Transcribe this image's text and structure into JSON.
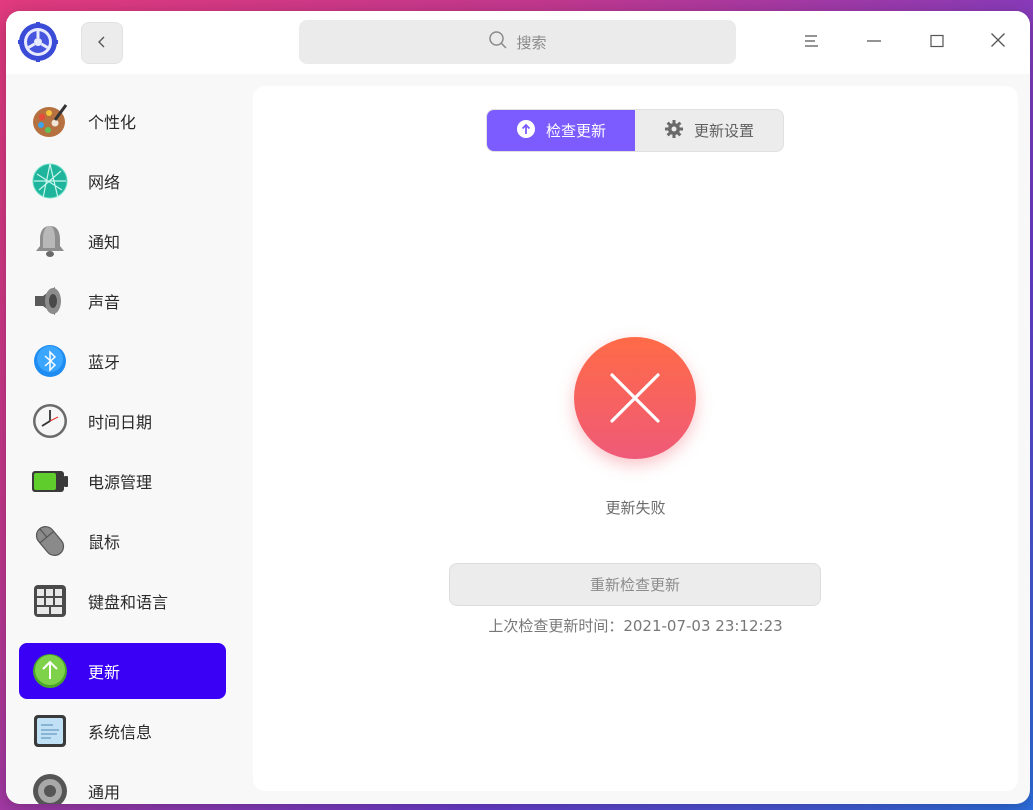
{
  "header": {
    "search_placeholder": "搜索"
  },
  "sidebar": {
    "items": [
      {
        "label": "个性化",
        "icon": "personalization-icon"
      },
      {
        "label": "网络",
        "icon": "network-icon"
      },
      {
        "label": "通知",
        "icon": "notification-bell-icon"
      },
      {
        "label": "声音",
        "icon": "speaker-icon"
      },
      {
        "label": "蓝牙",
        "icon": "bluetooth-icon"
      },
      {
        "label": "时间日期",
        "icon": "clock-icon"
      },
      {
        "label": "电源管理",
        "icon": "battery-icon"
      },
      {
        "label": "鼠标",
        "icon": "mouse-icon"
      },
      {
        "label": "键盘和语言",
        "icon": "keyboard-icon"
      },
      {
        "label": "更新",
        "icon": "update-arrow-icon",
        "active": true
      },
      {
        "label": "系统信息",
        "icon": "system-info-icon"
      },
      {
        "label": "通用",
        "icon": "general-gear-icon"
      }
    ]
  },
  "main": {
    "tabs": [
      {
        "label": "检查更新",
        "icon": "upload-arrow-icon",
        "active": true
      },
      {
        "label": "更新设置",
        "icon": "gear-icon",
        "active": false
      }
    ],
    "status_text": "更新失败",
    "retry_label": "重新检查更新",
    "last_check": "上次检查更新时间：2021-07-03 23:12:23"
  },
  "colors": {
    "accent": "#3a00f5",
    "tab_active": "#7c5cff",
    "error_top": "#ff6b47",
    "error_bottom": "#ef5a78"
  }
}
